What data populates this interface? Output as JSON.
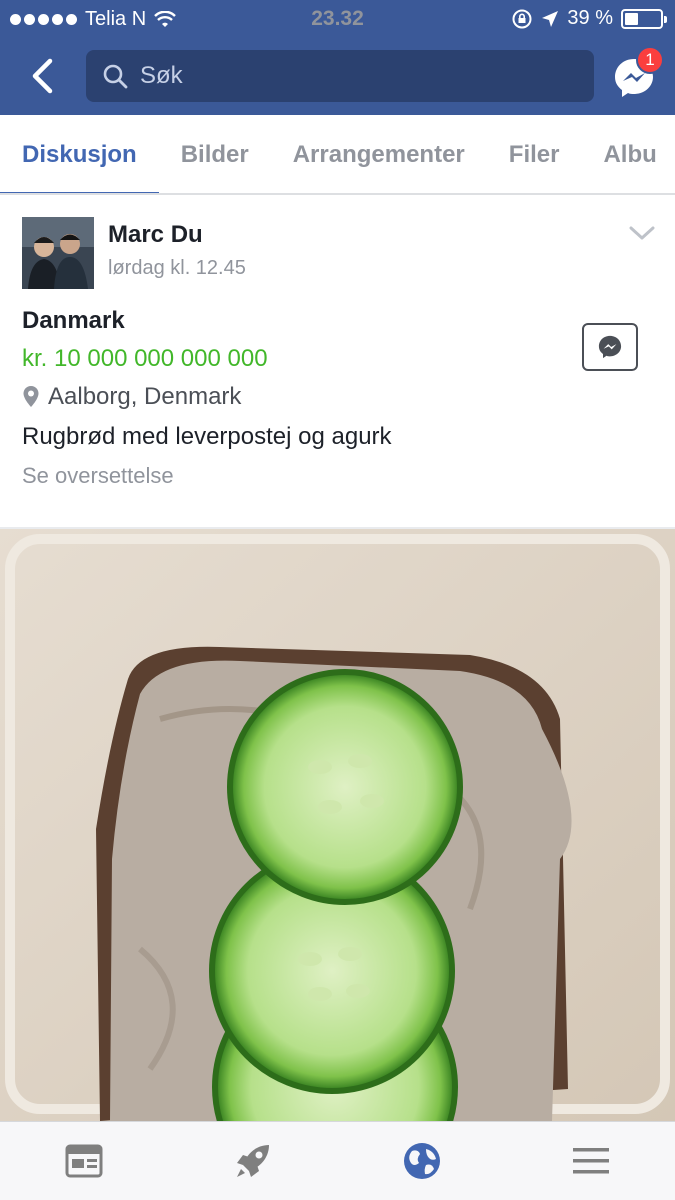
{
  "status": {
    "carrier": "Telia N",
    "time": "23.32",
    "battery": "39 %",
    "battery_level": 0.39
  },
  "nav": {
    "search_placeholder": "Søk",
    "messenger_badge": "1"
  },
  "tabs": [
    {
      "label": "Diskusjon",
      "active": true
    },
    {
      "label": "Bilder"
    },
    {
      "label": "Arrangementer"
    },
    {
      "label": "Filer"
    },
    {
      "label": "Albu"
    }
  ],
  "post": {
    "author": "Marc Du",
    "time": "lørdag kl. 12.45",
    "title": "Danmark",
    "price": "kr. 10 000 000 000 000",
    "location": "Aalborg, Denmark",
    "description": "Rugbrød med leverpostej og agurk",
    "translate_link": "Se oversettelse"
  },
  "colors": {
    "brand": "#3b5998",
    "accent": "#4267b2",
    "price": "#42b72a",
    "badge": "#fa3e3e"
  },
  "bottom_nav": [
    "feed-icon",
    "rocket-icon",
    "globe-icon",
    "menu-icon"
  ]
}
